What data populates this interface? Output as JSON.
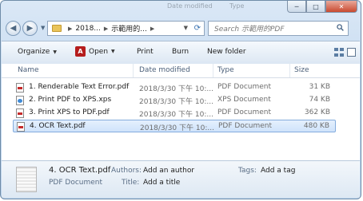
{
  "window": {
    "ghost_texts": [
      "Date modified",
      "Type"
    ],
    "captions": {
      "minimize": "─",
      "maximize": "□",
      "close": "✕"
    }
  },
  "nav": {
    "back": "◀",
    "forward": "▶",
    "address_segments": [
      "2018...",
      "示範用的..."
    ],
    "search_placeholder": "Search 示範用的PDF"
  },
  "toolbar": {
    "organize": "Organize",
    "open": "Open",
    "print": "Print",
    "burn": "Burn",
    "new_folder": "New folder",
    "help": "?"
  },
  "columns": {
    "name": "Name",
    "date": "Date modified",
    "type": "Type",
    "size": "Size"
  },
  "files": [
    {
      "icon": "pdf-file-icon",
      "name": "1. Renderable Text Error.pdf",
      "date": "2018/3/30 下午 10:...",
      "type": "PDF Document",
      "size": "31 KB"
    },
    {
      "icon": "xps-file-icon",
      "name": "2. Print PDF to XPS.xps",
      "date": "2018/3/30 下午 10:...",
      "type": "XPS Document",
      "size": "74 KB"
    },
    {
      "icon": "pdf-file-icon",
      "name": "3. Print XPS to PDF.pdf",
      "date": "2018/3/30 下午 10:...",
      "type": "PDF Document",
      "size": "362 KB"
    },
    {
      "icon": "pdf-file-icon",
      "name": "4. OCR Text.pdf",
      "date": "2018/3/30 下午 10:...",
      "type": "PDF Document",
      "size": "480 KB",
      "selected": true
    }
  ],
  "details": {
    "filename": "4. OCR Text.pdf",
    "filetype": "PDF Document",
    "authors_label": "Authors:",
    "authors_value": "Add an author",
    "title_label": "Title:",
    "title_value": "Add a title",
    "tags_label": "Tags:",
    "tags_value": "Add a tag"
  },
  "colors": {
    "selection": "#cfe3fb",
    "frame": "#c6dbf1",
    "pdf_red": "#c62a2a"
  }
}
